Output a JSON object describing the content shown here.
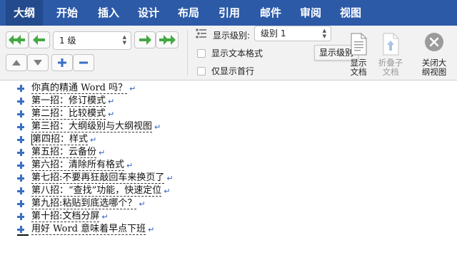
{
  "tabs": [
    {
      "label": "大纲",
      "active": true
    },
    {
      "label": "开始"
    },
    {
      "label": "插入"
    },
    {
      "label": "设计"
    },
    {
      "label": "布局"
    },
    {
      "label": "引用"
    },
    {
      "label": "邮件"
    },
    {
      "label": "审阅"
    },
    {
      "label": "视图"
    }
  ],
  "ribbon": {
    "level_select_value": "1 级",
    "show_level_label": "显示级别:",
    "show_level_value": "级别 1",
    "show_text_format_label": "显示文本格式",
    "first_line_only_label": "仅显示首行",
    "show_document_label": "显示\n文档",
    "collapse_subdoc_label": "折叠子\n文档",
    "close_outline_label": "关闭大\n纲视图",
    "tooltip": "显示级别"
  },
  "colors": {
    "tabbar": "#2c5aa7",
    "arrow_green": "#45a843",
    "arrow_gray": "#7f7f7f",
    "plus_blue": "#3a6fc4",
    "para_mark": "#2f5fb8"
  },
  "icons": {
    "promote_to_heading": "double-left-arrow-icon",
    "promote": "left-arrow-icon",
    "demote": "right-arrow-icon",
    "demote_to_body": "double-right-arrow-icon",
    "move_up": "triangle-up-icon",
    "move_down": "triangle-down-icon",
    "expand": "plus-icon",
    "collapse": "minus-icon",
    "close": "close-circle-icon"
  },
  "outline": [
    "你真的精通 Word 吗？",
    "第一招：修订模式",
    "第二招：比较模式",
    "第三招：大纲级别与大纲视图",
    "第四招：样式",
    "第五招：云备份",
    "第六招：清除所有格式",
    "第七招:不要再狂敲回车来换页了",
    "第八招：“查找”功能，快速定位",
    "第九招:粘贴到底选哪个？",
    "第十招:文档分屏",
    "用好 Word 意味着早点下班"
  ]
}
